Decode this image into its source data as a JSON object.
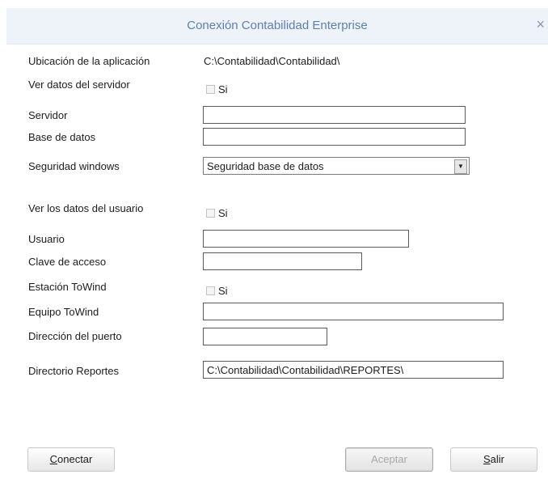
{
  "window": {
    "title": "Conexión Contabilidad Enterprise",
    "close_glyph": "×"
  },
  "fields": {
    "ubicacion": {
      "label": "Ubicación de la aplicación",
      "value": "C:\\Contabilidad\\Contabilidad\\"
    },
    "ver_servidor": {
      "label": "Ver datos del servidor",
      "checkbox_label": "Si",
      "checked": false
    },
    "servidor": {
      "label": "Servidor",
      "value": ""
    },
    "base_datos": {
      "label": "Base de datos",
      "value": ""
    },
    "seguridad": {
      "label": "Seguridad windows",
      "selected": "Seguridad base de datos"
    },
    "ver_usuario": {
      "label": "Ver los datos del usuario",
      "checkbox_label": "Si",
      "checked": false
    },
    "usuario": {
      "label": "Usuario",
      "value": ""
    },
    "clave": {
      "label": "Clave de acceso",
      "value": ""
    },
    "estacion": {
      "label": "Estación ToWind",
      "checkbox_label": "Si",
      "checked": false
    },
    "equipo": {
      "label": "Equipo ToWind",
      "value": ""
    },
    "puerto": {
      "label": "Dirección del puerto",
      "value": ""
    },
    "reportes": {
      "label": "Directorio Reportes",
      "value": "C:\\Contabilidad\\Contabilidad\\REPORTES\\"
    }
  },
  "buttons": {
    "conectar": {
      "mnemonic": "C",
      "rest": "onectar"
    },
    "aceptar": {
      "label": "Aceptar",
      "enabled": false
    },
    "salir": {
      "mnemonic": "S",
      "rest": "alir"
    }
  },
  "icons": {
    "select_arrow": "dropdown-arrow-icon"
  },
  "colors": {
    "title": "#5c7fb0",
    "titlebar_bg": "#eef3fa"
  }
}
